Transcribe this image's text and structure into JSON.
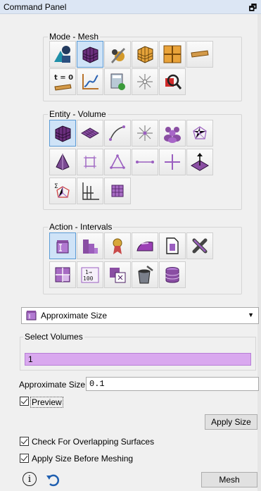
{
  "window": {
    "title": "Command Panel",
    "pin_glyph": "🗗"
  },
  "mode_group": {
    "legend": "Mode - Mesh",
    "buttons": [
      {
        "icon": "shapes-icon"
      },
      {
        "icon": "meshed-cube-icon",
        "selected": true
      },
      {
        "icon": "tools-wrench-icon"
      },
      {
        "icon": "hex-cube-icon"
      },
      {
        "icon": "grid-quad-icon"
      },
      {
        "icon": "flat-plate-icon"
      },
      {
        "icon": "time-zero-icon",
        "text": "t = 0"
      },
      {
        "icon": "graph-icon"
      },
      {
        "icon": "calculator-icon"
      },
      {
        "icon": "spark-node-icon"
      },
      {
        "icon": "zoom-mesh-icon"
      }
    ]
  },
  "entity_group": {
    "legend": "Entity - Volume",
    "buttons": [
      {
        "icon": "volume-cube-icon",
        "selected": true
      },
      {
        "icon": "surface-grid-icon"
      },
      {
        "icon": "curve-icon"
      },
      {
        "icon": "vertex-star-icon"
      },
      {
        "icon": "group-people-icon"
      },
      {
        "icon": "node-network-icon"
      },
      {
        "icon": "tetra-icon"
      },
      {
        "icon": "quad-element-icon"
      },
      {
        "icon": "triangle-element-icon"
      },
      {
        "icon": "edge-element-icon"
      },
      {
        "icon": "node-plus-icon"
      },
      {
        "icon": "pyramid-arrow-icon"
      },
      {
        "icon": "sigma-network-icon"
      },
      {
        "icon": "axis-plane-icon"
      },
      {
        "icon": "table-grid-icon"
      }
    ]
  },
  "action_group": {
    "legend": "Action - Intervals",
    "buttons": [
      {
        "icon": "interval-icon",
        "selected": true
      },
      {
        "icon": "bar-blocks-icon"
      },
      {
        "icon": "ribbon-icon"
      },
      {
        "icon": "iron-icon"
      },
      {
        "icon": "page-copy-icon"
      },
      {
        "icon": "delete-x-icon"
      },
      {
        "icon": "split-block-icon"
      },
      {
        "icon": "counter-icon",
        "text": "1→\n100"
      },
      {
        "icon": "copy-block-icon"
      },
      {
        "icon": "paint-bucket-icon"
      },
      {
        "icon": "database-icon"
      }
    ]
  },
  "scheme_select": {
    "value": "Approximate Size"
  },
  "select_volumes": {
    "legend": "Select Volumes",
    "value": "1"
  },
  "approx_size": {
    "label": "Approximate Size",
    "value": "0.1"
  },
  "preview": {
    "label": "Preview",
    "checked": true
  },
  "apply_size_button": "Apply Size",
  "check_overlap": {
    "label": "Check For Overlapping Surfaces",
    "checked": true
  },
  "apply_before_meshing": {
    "label": "Apply Size Before Meshing",
    "checked": true
  },
  "mesh_button": "Mesh",
  "footer": {
    "info_glyph": "i"
  },
  "colors": {
    "accent_purple": "#9b5fc0",
    "select_fill": "#d9a8ef",
    "selected_button": "#cfe3f7"
  }
}
